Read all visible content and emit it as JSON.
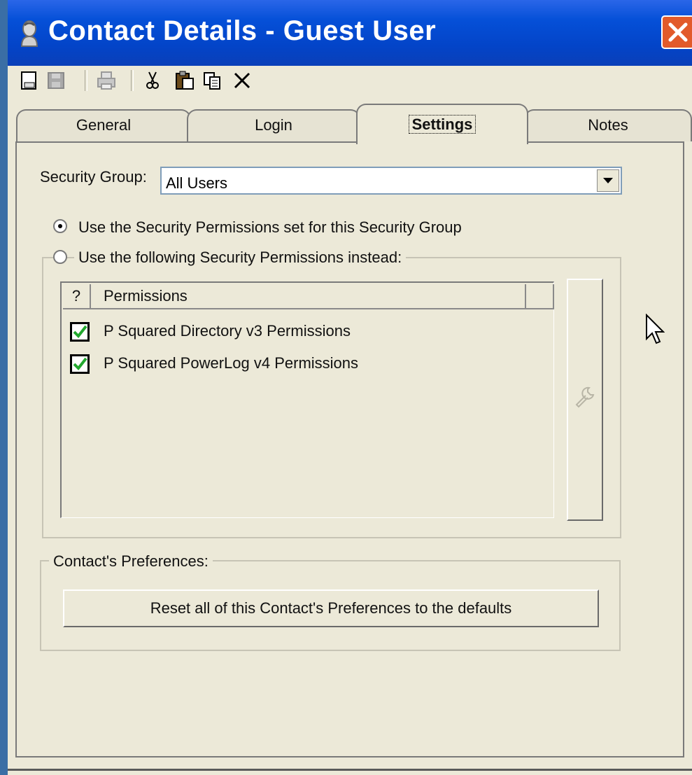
{
  "window": {
    "title": "Contact Details - Guest User",
    "icon": "contact-bust-icon",
    "close_icon": "close-x-icon",
    "title_bar_color": "#0550d8",
    "close_button_color": "#e25a2a"
  },
  "toolbar": {
    "buttons": [
      {
        "name": "new-icon",
        "enabled": true
      },
      {
        "name": "save-icon",
        "enabled": false
      },
      {
        "name": "print-icon",
        "enabled": false
      },
      {
        "name": "cut-icon",
        "enabled": true
      },
      {
        "name": "paste-icon",
        "enabled": true
      },
      {
        "name": "copy-icon",
        "enabled": true
      },
      {
        "name": "delete-icon",
        "enabled": true
      }
    ]
  },
  "tabs": [
    {
      "label": "General",
      "active": false
    },
    {
      "label": "Login",
      "active": false
    },
    {
      "label": "Settings",
      "active": true
    },
    {
      "label": "Notes",
      "active": false
    }
  ],
  "settings": {
    "security_group_label": "Security Group:",
    "security_group_value": "All Users",
    "radio_group_permissions": "Use the Security Permissions set for this Security Group",
    "radio_following_permissions": "Use the following Security Permissions instead:",
    "selected_radio": "group_permissions",
    "permissions_list": {
      "headers": [
        "?",
        "Permissions",
        ""
      ],
      "rows": [
        {
          "checked": true,
          "label": "P Squared Directory v3 Permissions"
        },
        {
          "checked": true,
          "label": "P Squared PowerLog v4 Permissions"
        }
      ]
    },
    "side_button_icon": "wrench-icon",
    "preferences_group_label": "Contact's Preferences:",
    "reset_button_label": "Reset all of this Contact's Preferences to the defaults"
  }
}
